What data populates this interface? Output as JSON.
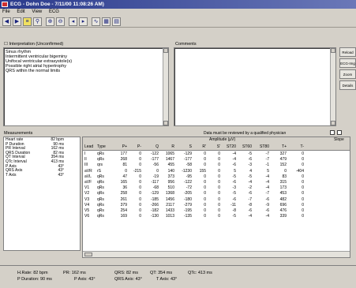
{
  "window": {
    "title": "ECG - Dohn Doe - 7/11/00 11:08:26 AM)"
  },
  "menu": [
    "File",
    "Edit",
    "View",
    "ECG"
  ],
  "toolbar": {
    "icons": [
      "prev-icon",
      "next-icon",
      "grid-view-icon",
      "search-icon",
      "zoom-in-icon",
      "zoom-out-icon",
      "back-icon",
      "forward-icon",
      "waveform-icon",
      "lead-grid-icon",
      "layout-icon"
    ]
  },
  "interpretation": {
    "label": "Interpretation (Unconfirmed)",
    "lines": [
      "Sinus rhythm",
      "Intermittent ventricular bigeminy",
      "Unifocal ventricular extrasystole(s)",
      "Possible right atrial hypertrophy",
      "QRS within the normal limits"
    ]
  },
  "comments": {
    "label": "Comments"
  },
  "side_buttons": [
    "Reload",
    "ECG-Img",
    "Zoom",
    "Details"
  ],
  "measurements": {
    "label": "Measurements",
    "rows": [
      {
        "k": "Heart rate",
        "v": "82 bpm"
      },
      {
        "k": "P Duration",
        "v": "90 ms"
      },
      {
        "k": "PR Interval",
        "v": "162 ms"
      },
      {
        "k": "QRS Duration",
        "v": "82 ms"
      },
      {
        "k": "QT Interval",
        "v": "354 ms"
      },
      {
        "k": "QTc Interval",
        "v": "413 ms"
      },
      {
        "k": "P Axis",
        "v": "43°"
      },
      {
        "k": "QRS Axis",
        "v": "43°"
      },
      {
        "k": "T Axis",
        "v": "43°"
      }
    ]
  },
  "table_note": "Data must be reviewed by a qualified physician",
  "table": {
    "group_header": "Amplitude (µV)",
    "slope_header": "Slope",
    "columns": [
      "Lead",
      "Type",
      "P+",
      "P-",
      "Q",
      "R",
      "S",
      "R'",
      "S'",
      "ST20",
      "ST60",
      "ST80",
      "T+",
      "T-"
    ],
    "rows": [
      [
        "I",
        "qRs",
        "177",
        "0",
        "-122",
        "1065",
        "-129",
        "0",
        "0",
        "-4",
        "-5",
        "-7",
        "327",
        "0"
      ],
      [
        "II",
        "qRs",
        "268",
        "0",
        "-177",
        "1467",
        "-177",
        "0",
        "0",
        "-4",
        "-6",
        "-7",
        "479",
        "0"
      ],
      [
        "III",
        "qrs",
        "81",
        "0",
        "-56",
        "455",
        "-58",
        "0",
        "0",
        "-6",
        "-3",
        "-1",
        "152",
        "0"
      ],
      [
        "aVR",
        "rS",
        "0",
        "-215",
        "0",
        "140",
        "-1230",
        "155",
        "0",
        "5",
        "4",
        "5",
        "0",
        "-404"
      ],
      [
        "aVL",
        "qRs",
        "47",
        "0",
        "-19",
        "373",
        "-95",
        "0",
        "0",
        "-5",
        "-5",
        "-4",
        "83",
        "0"
      ],
      [
        "aVF",
        "qRs",
        "165",
        "0",
        "-117",
        "956",
        "-122",
        "0",
        "0",
        "-6",
        "-4",
        "-4",
        "315",
        "0"
      ],
      [
        "V1",
        "qRs",
        "36",
        "0",
        "-68",
        "510",
        "-72",
        "0",
        "0",
        "-3",
        "-2",
        "-4",
        "173",
        "0"
      ],
      [
        "V2",
        "qRs",
        "258",
        "0",
        "-129",
        "1368",
        "-205",
        "0",
        "0",
        "-5",
        "-6",
        "-7",
        "453",
        "0"
      ],
      [
        "V3",
        "qRs",
        "261",
        "0",
        "-185",
        "1456",
        "-180",
        "0",
        "0",
        "-6",
        "-7",
        "-6",
        "482",
        "0"
      ],
      [
        "V4",
        "qRs",
        "379",
        "0",
        "-266",
        "2117",
        "-279",
        "0",
        "0",
        "-11",
        "-8",
        "-9",
        "696",
        "0"
      ],
      [
        "V5",
        "qRs",
        "254",
        "0",
        "-182",
        "1433",
        "-195",
        "0",
        "0",
        "-8",
        "-6",
        "-6",
        "476",
        "0"
      ],
      [
        "V6",
        "qRs",
        "169",
        "0",
        "-130",
        "1013",
        "-135",
        "0",
        "0",
        "-5",
        "-4",
        "-4",
        "339",
        "0"
      ]
    ]
  },
  "status": {
    "row1": [
      {
        "k": "H.Rate:",
        "v": "82 bpm"
      },
      {
        "k": "PR:",
        "v": "162 ms"
      },
      {
        "k": "QRS:",
        "v": "82 ms"
      },
      {
        "k": "QT:",
        "v": "354 ms"
      },
      {
        "k": "QTc:",
        "v": "413 ms"
      }
    ],
    "row2": [
      {
        "k": "P Duration:",
        "v": "90 ms"
      },
      {
        "k": "P Axis:",
        "v": "43°"
      },
      {
        "k": "QRS Axis:",
        "v": "43°"
      },
      {
        "k": "T Axis:",
        "v": "43°"
      }
    ]
  }
}
